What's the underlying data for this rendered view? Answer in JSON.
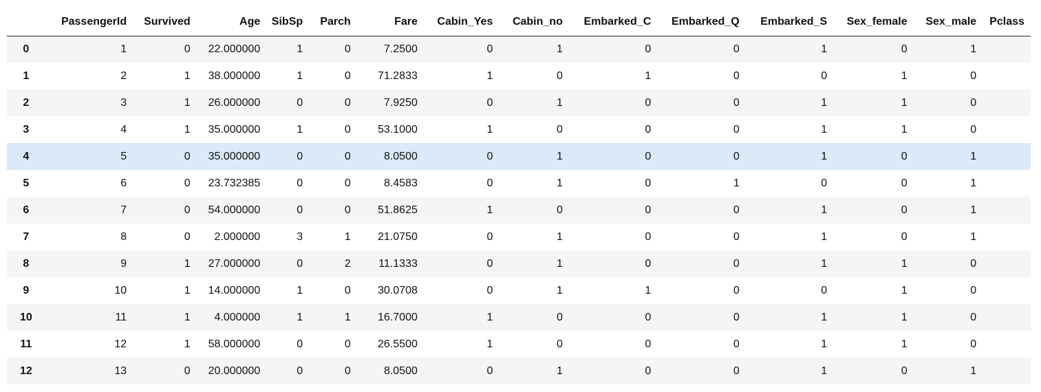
{
  "dataframe": {
    "columns": [
      "PassengerId",
      "Survived",
      "Age",
      "SibSp",
      "Parch",
      "Fare",
      "Cabin_Yes",
      "Cabin_no",
      "Embarked_C",
      "Embarked_Q",
      "Embarked_S",
      "Sex_female",
      "Sex_male",
      "Pclass"
    ],
    "highlighted_row_index": "4",
    "rows": [
      {
        "index": "0",
        "cells": [
          "1",
          "0",
          "22.000000",
          "1",
          "0",
          "7.2500",
          "0",
          "1",
          "0",
          "0",
          "1",
          "0",
          "1",
          ""
        ]
      },
      {
        "index": "1",
        "cells": [
          "2",
          "1",
          "38.000000",
          "1",
          "0",
          "71.2833",
          "1",
          "0",
          "1",
          "0",
          "0",
          "1",
          "0",
          ""
        ]
      },
      {
        "index": "2",
        "cells": [
          "3",
          "1",
          "26.000000",
          "0",
          "0",
          "7.9250",
          "0",
          "1",
          "0",
          "0",
          "1",
          "1",
          "0",
          ""
        ]
      },
      {
        "index": "3",
        "cells": [
          "4",
          "1",
          "35.000000",
          "1",
          "0",
          "53.1000",
          "1",
          "0",
          "0",
          "0",
          "1",
          "1",
          "0",
          ""
        ]
      },
      {
        "index": "4",
        "cells": [
          "5",
          "0",
          "35.000000",
          "0",
          "0",
          "8.0500",
          "0",
          "1",
          "0",
          "0",
          "1",
          "0",
          "1",
          ""
        ]
      },
      {
        "index": "5",
        "cells": [
          "6",
          "0",
          "23.732385",
          "0",
          "0",
          "8.4583",
          "0",
          "1",
          "0",
          "1",
          "0",
          "0",
          "1",
          ""
        ]
      },
      {
        "index": "6",
        "cells": [
          "7",
          "0",
          "54.000000",
          "0",
          "0",
          "51.8625",
          "1",
          "0",
          "0",
          "0",
          "1",
          "0",
          "1",
          ""
        ]
      },
      {
        "index": "7",
        "cells": [
          "8",
          "0",
          "2.000000",
          "3",
          "1",
          "21.0750",
          "0",
          "1",
          "0",
          "0",
          "1",
          "0",
          "1",
          ""
        ]
      },
      {
        "index": "8",
        "cells": [
          "9",
          "1",
          "27.000000",
          "0",
          "2",
          "11.1333",
          "0",
          "1",
          "0",
          "0",
          "1",
          "1",
          "0",
          ""
        ]
      },
      {
        "index": "9",
        "cells": [
          "10",
          "1",
          "14.000000",
          "1",
          "0",
          "30.0708",
          "0",
          "1",
          "1",
          "0",
          "0",
          "1",
          "0",
          ""
        ]
      },
      {
        "index": "10",
        "cells": [
          "11",
          "1",
          "4.000000",
          "1",
          "1",
          "16.7000",
          "1",
          "0",
          "0",
          "0",
          "1",
          "1",
          "0",
          ""
        ]
      },
      {
        "index": "11",
        "cells": [
          "12",
          "1",
          "58.000000",
          "0",
          "0",
          "26.5500",
          "1",
          "0",
          "0",
          "0",
          "1",
          "1",
          "0",
          ""
        ]
      },
      {
        "index": "12",
        "cells": [
          "13",
          "0",
          "20.000000",
          "0",
          "0",
          "8.0500",
          "0",
          "1",
          "0",
          "0",
          "1",
          "0",
          "1",
          ""
        ]
      }
    ]
  },
  "colors": {
    "row_stripe": "#f5f5f5",
    "row_hover": "#daeaf9",
    "header_border": "#222222"
  }
}
